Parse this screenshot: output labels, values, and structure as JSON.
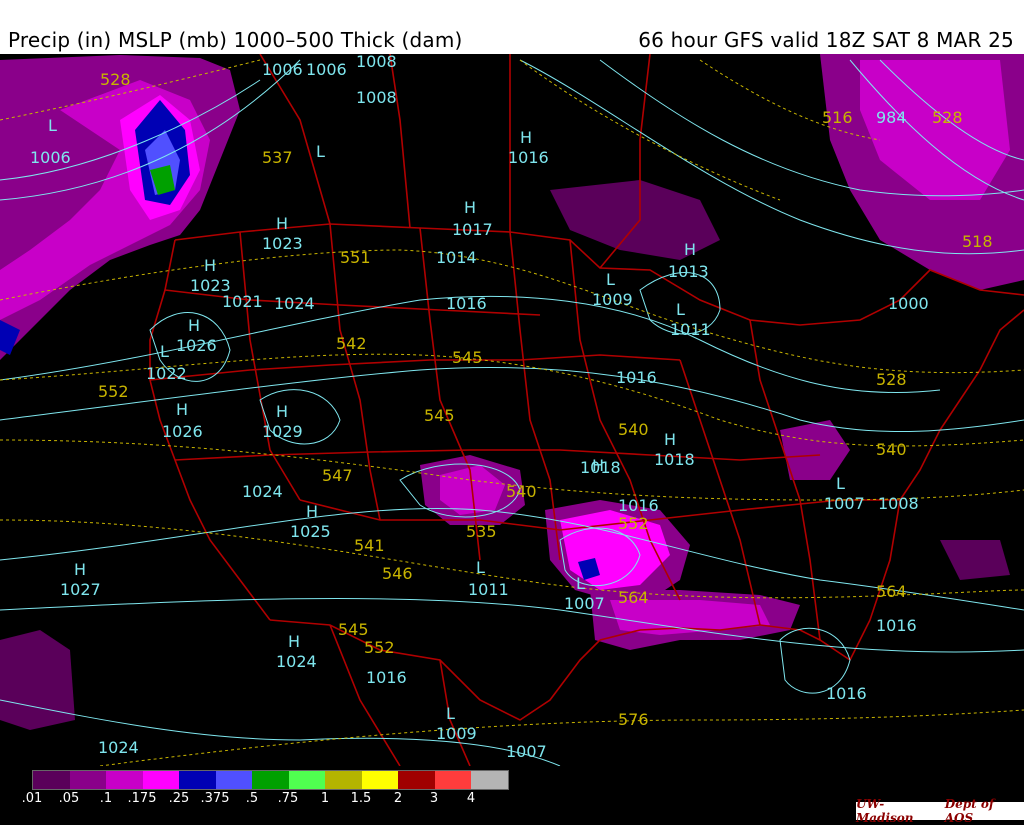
{
  "header": {
    "title_left": "Precip (in) MSLP (mb) 1000–500 Thick (dam)",
    "title_right": "66 hour GFS valid 18Z SAT  8 MAR 25"
  },
  "colors": {
    "background": "#000000",
    "isobars": "#7fe6ee",
    "thickness": "#c8b400",
    "borders": "#b00000"
  },
  "legend": {
    "colors": [
      "#5a005a",
      "#8a008a",
      "#c800c8",
      "#ff00ff",
      "#0000b4",
      "#5050ff",
      "#00a000",
      "#50ff50",
      "#b4b400",
      "#ffff00",
      "#a00000",
      "#ff3c3c",
      "#b4b4b4"
    ],
    "ticks": [
      ".01",
      ".05",
      ".1",
      ".175",
      ".25",
      ".375",
      ".5",
      ".75",
      "1",
      "1.5",
      "2",
      "3",
      "4"
    ]
  },
  "map_labels": {
    "isobar": [
      "1006",
      "1006",
      "1008",
      "1008",
      "1016",
      "1023",
      "1023",
      "1021",
      "1024",
      "1026",
      "1022",
      "1026",
      "1029",
      "1024",
      "1025",
      "1027",
      "1024",
      "1017",
      "1014",
      "1016",
      "1009",
      "1011",
      "1013",
      "1016",
      "1018",
      "1016",
      "1007",
      "1011",
      "1007",
      "1008",
      "1018",
      "1016",
      "1009",
      "1016",
      "1016",
      "1006",
      "1000",
      "1007",
      "984",
      "1024"
    ],
    "pressure_centers": [
      "H",
      "H",
      "H",
      "H",
      "H",
      "H",
      "H",
      "H",
      "H",
      "L",
      "L",
      "L",
      "L",
      "L",
      "L",
      "L",
      "L",
      "L",
      "H",
      "H",
      "H",
      "H"
    ],
    "thickness": [
      "528",
      "537",
      "551",
      "542",
      "545",
      "552",
      "547",
      "545",
      "540",
      "541",
      "546",
      "535",
      "540",
      "564",
      "576",
      "564",
      "528",
      "540",
      "552",
      "516",
      "528",
      "545",
      "552",
      "518"
    ]
  },
  "credit": {
    "org": "UW-Madison",
    "dept": "Dept of AOS"
  }
}
